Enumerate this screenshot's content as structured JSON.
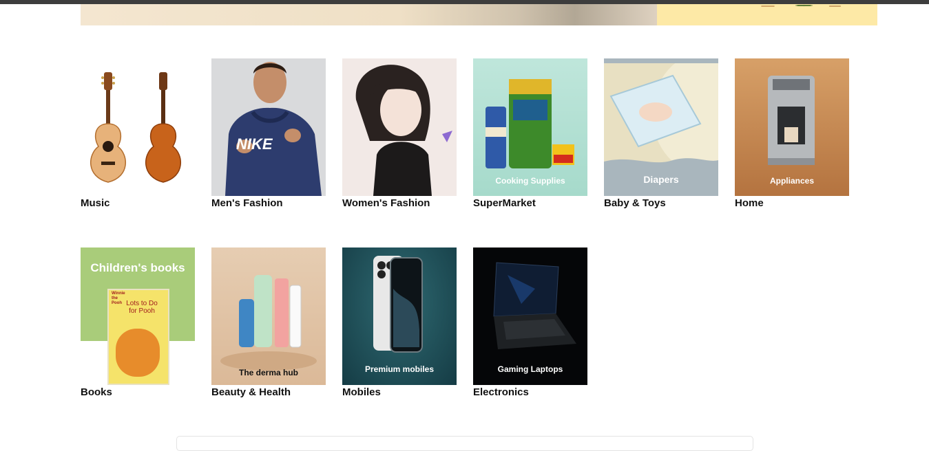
{
  "categories": [
    {
      "label": "Music",
      "caption": ""
    },
    {
      "label": "Men's Fashion",
      "caption": ""
    },
    {
      "label": "Women's Fashion",
      "caption": ""
    },
    {
      "label": "SuperMarket",
      "caption": "Cooking Supplies"
    },
    {
      "label": "Baby & Toys",
      "caption": "Diapers"
    },
    {
      "label": "Home",
      "caption": "Appliances"
    },
    {
      "label": "Books",
      "caption": "Children's books"
    },
    {
      "label": "Beauty & Health",
      "caption": "The derma hub"
    },
    {
      "label": "Mobiles",
      "caption": "Premium mobiles"
    },
    {
      "label": "Electronics",
      "caption": "Gaming Laptops"
    }
  ],
  "shirt_brand": "NIKE",
  "book_title": "Lots to Do for Pooh",
  "book_series": "Winnie the Pooh"
}
